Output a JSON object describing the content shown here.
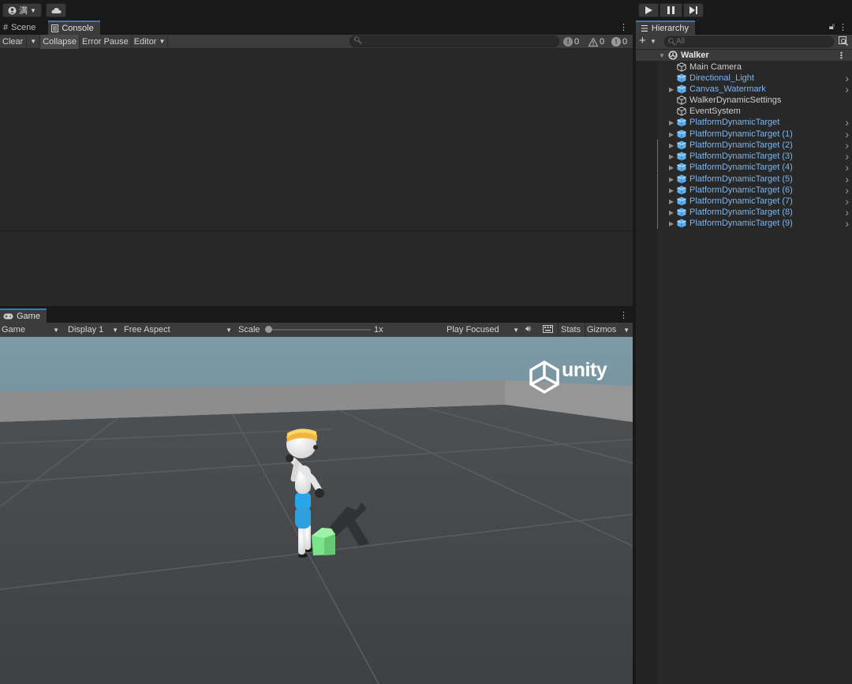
{
  "toolbar": {
    "account_label": "满",
    "account_icon": "account-icon",
    "cloud_icon": "cloud-icon",
    "play_icon": "play-icon",
    "pause_icon": "pause-icon",
    "step_icon": "step-icon"
  },
  "console": {
    "tabs": [
      {
        "label": "Scene",
        "icon": "grid-icon"
      },
      {
        "label": "Console",
        "icon": "console-icon"
      }
    ],
    "buttons": {
      "clear": "Clear",
      "collapse": "Collapse",
      "error_pause": "Error Pause",
      "editor": "Editor"
    },
    "counts": {
      "log": "0",
      "warning": "0",
      "error": "0"
    }
  },
  "game": {
    "tab_label": "Game",
    "view_dropdown": "Game",
    "display_dropdown": "Display 1",
    "aspect_dropdown": "Free Aspect",
    "scale_label": "Scale",
    "scale_value": "1x",
    "play_mode": "Play Focused",
    "stats": "Stats",
    "gizmos": "Gizmos",
    "watermark": "unity"
  },
  "hierarchy": {
    "tab_label": "Hierarchy",
    "search_placeholder": "All",
    "scene": "Walker",
    "items": [
      {
        "label": "Main Camera",
        "prefab": false,
        "expandable": false
      },
      {
        "label": "Directional_Light",
        "prefab": true,
        "expandable": false
      },
      {
        "label": "Canvas_Watermark",
        "prefab": true,
        "expandable": true
      },
      {
        "label": "WalkerDynamicSettings",
        "prefab": false,
        "expandable": false
      },
      {
        "label": "EventSystem",
        "prefab": false,
        "expandable": false
      },
      {
        "label": "PlatformDynamicTarget",
        "prefab": true,
        "expandable": true
      },
      {
        "label": "PlatformDynamicTarget (1)",
        "prefab": true,
        "expandable": true
      },
      {
        "label": "PlatformDynamicTarget (2)",
        "prefab": true,
        "expandable": true
      },
      {
        "label": "PlatformDynamicTarget (3)",
        "prefab": true,
        "expandable": true
      },
      {
        "label": "PlatformDynamicTarget (4)",
        "prefab": true,
        "expandable": true
      },
      {
        "label": "PlatformDynamicTarget (5)",
        "prefab": true,
        "expandable": true
      },
      {
        "label": "PlatformDynamicTarget (6)",
        "prefab": true,
        "expandable": true
      },
      {
        "label": "PlatformDynamicTarget (7)",
        "prefab": true,
        "expandable": true
      },
      {
        "label": "PlatformDynamicTarget (8)",
        "prefab": true,
        "expandable": true
      },
      {
        "label": "PlatformDynamicTarget (9)",
        "prefab": true,
        "expandable": true
      }
    ]
  },
  "colors": {
    "accent": "#3a79bb",
    "prefab_text": "#7cb5ee",
    "sky": "#7a96a3",
    "floor": "#474a4d"
  }
}
